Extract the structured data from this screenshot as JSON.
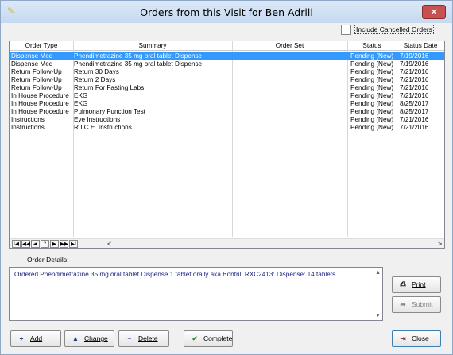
{
  "window": {
    "title": "Orders from this Visit for Ben Adrill",
    "close_label": "✕"
  },
  "options": {
    "include_cancelled_label": "Include Cancelled Orders",
    "include_cancelled_checked": false
  },
  "grid": {
    "columns": [
      "Order Type",
      "Summary",
      "Order Set",
      "Status",
      "Status Date"
    ],
    "rows": [
      {
        "type": "Dispense Med",
        "summary": "Phendimetrazine 35 mg oral tablet Dispense",
        "order_set": "",
        "status": "Pending (New)",
        "date": "7/19/2016",
        "selected": true
      },
      {
        "type": "Dispense Med",
        "summary": "Phendimetrazine 35 mg oral tablet Dispense",
        "order_set": "",
        "status": "Pending (New)",
        "date": "7/19/2016",
        "selected": false
      },
      {
        "type": "Return Follow-Up",
        "summary": "Return 30 Days",
        "order_set": "",
        "status": "Pending (New)",
        "date": "7/21/2016",
        "selected": false
      },
      {
        "type": "Return Follow-Up",
        "summary": "Return 2 Days",
        "order_set": "",
        "status": "Pending (New)",
        "date": "7/21/2016",
        "selected": false
      },
      {
        "type": "Return Follow-Up",
        "summary": "Return For Fasting Labs",
        "order_set": "",
        "status": "Pending (New)",
        "date": "7/21/2016",
        "selected": false
      },
      {
        "type": "In House Procedure",
        "summary": "EKG",
        "order_set": "",
        "status": "Pending (New)",
        "date": "7/21/2016",
        "selected": false
      },
      {
        "type": "In House Procedure",
        "summary": "EKG",
        "order_set": "",
        "status": "Pending (New)",
        "date": "8/25/2017",
        "selected": false
      },
      {
        "type": "In House Procedure",
        "summary": "Pulmonary Function Test",
        "order_set": "",
        "status": "Pending (New)",
        "date": "8/25/2017",
        "selected": false
      },
      {
        "type": "Instructions",
        "summary": "Eye Instructions",
        "order_set": "",
        "status": "Pending (New)",
        "date": "7/21/2016",
        "selected": false
      },
      {
        "type": "Instructions",
        "summary": "R.I.C.E. Instructions",
        "order_set": "",
        "status": "Pending (New)",
        "date": "7/21/2016",
        "selected": false
      }
    ],
    "navigator": [
      "I◀",
      "◀◀",
      "◀",
      "?",
      "▶",
      "▶▶",
      "▶I"
    ],
    "scroll_left": "<",
    "scroll_right": ">"
  },
  "details": {
    "label": "Order Details:",
    "text": "Ordered Phendimetrazine 35 mg oral tablet Dispense.1 tablet orally aka Bontril.  RXC2413: Dispense: 14 tablets."
  },
  "buttons": {
    "print": "Print",
    "submit": "Submit",
    "add": "Add",
    "change": "Change",
    "delete": "Delete",
    "complete": "Complete",
    "close": "Close"
  },
  "colors": {
    "selection": "#3399ff",
    "details_text": "#1a237e",
    "titlebar_close": "#c75050"
  }
}
